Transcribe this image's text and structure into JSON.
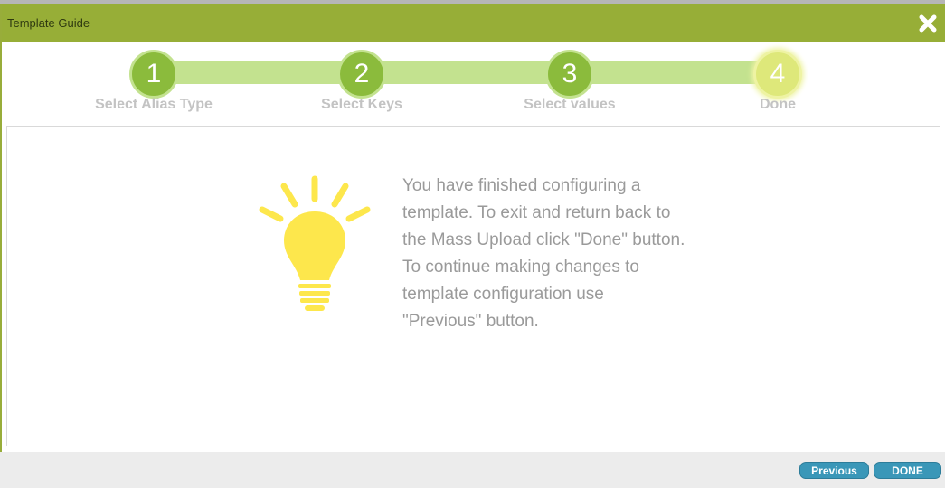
{
  "dialog": {
    "title": "Template Guide",
    "close_icon": "close-icon"
  },
  "colors": {
    "titlebar": "#97ae37",
    "step_done": "#8bbb3c",
    "step_active": "#dee87a",
    "track": "#c3e28f",
    "bulb": "#fde74c",
    "button": "#3a97b8"
  },
  "wizard": {
    "steps": [
      {
        "number": "1",
        "label": "Select Alias Type",
        "state": "complete"
      },
      {
        "number": "2",
        "label": "Select Keys",
        "state": "complete"
      },
      {
        "number": "3",
        "label": "Select values",
        "state": "complete"
      },
      {
        "number": "4",
        "label": "Done",
        "state": "current"
      }
    ]
  },
  "content": {
    "icon": "lightbulb-icon",
    "message_lines": [
      "You have finished configuring a",
      "template. To exit and return back to",
      "the Mass Upload click \"Done\" button.",
      "To continue making changes to",
      "template configuration use",
      "\"Previous\" button."
    ]
  },
  "footer": {
    "previous_label": "Previous",
    "done_label": "DONE"
  }
}
